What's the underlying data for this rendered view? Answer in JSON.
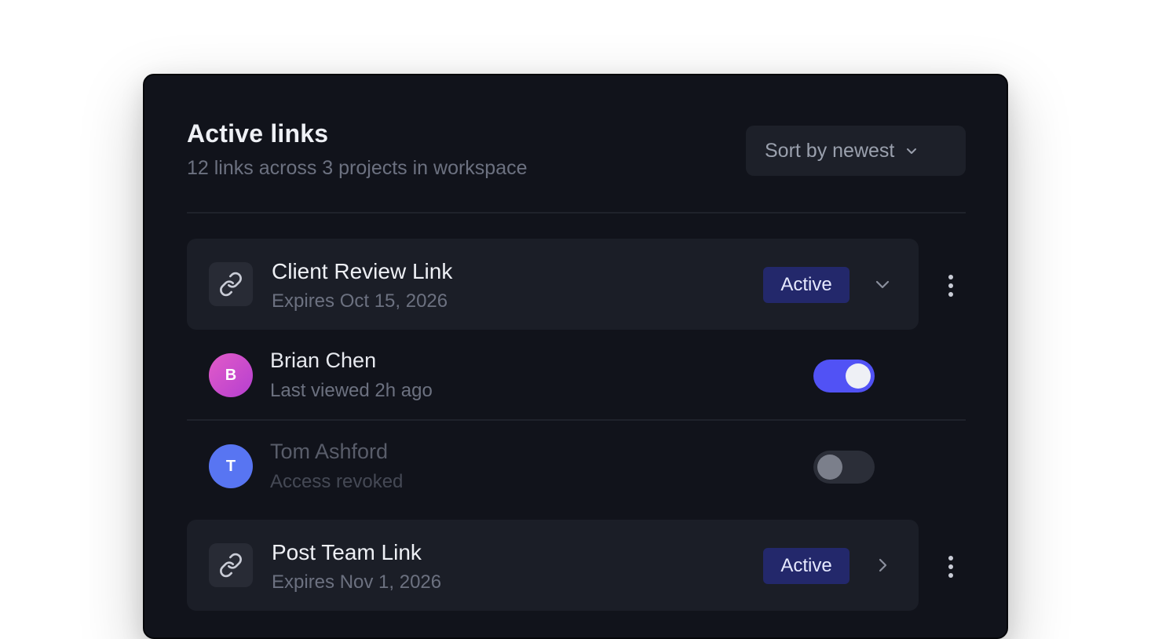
{
  "header": {
    "title": "Active links",
    "subtitle": "12 links across 3 projects in workspace"
  },
  "sort": {
    "label": "Sort by newest",
    "icon": "chevron-down-icon"
  },
  "links": [
    {
      "name": "Client Review Link",
      "expiry": "Expires Oct 15, 2026",
      "status": "Active",
      "expanded": true,
      "icon": "link-icon"
    },
    {
      "name": "Post Team Link",
      "expiry": "Expires Nov 1, 2026",
      "status": "Active",
      "expanded": false,
      "icon": "link-icon"
    }
  ],
  "people": [
    {
      "initial": "B",
      "name": "Brian Chen",
      "status": "Last viewed 2h ago",
      "enabled": true
    },
    {
      "initial": "T",
      "name": "Tom Ashford",
      "status": "Access revoked",
      "enabled": false
    }
  ],
  "colors": {
    "accent": "#5152f5",
    "badge_bg": "#23286b",
    "panel_bg": "#11131b",
    "avatar_b": "#d044c4",
    "avatar_t": "#5875f2"
  }
}
